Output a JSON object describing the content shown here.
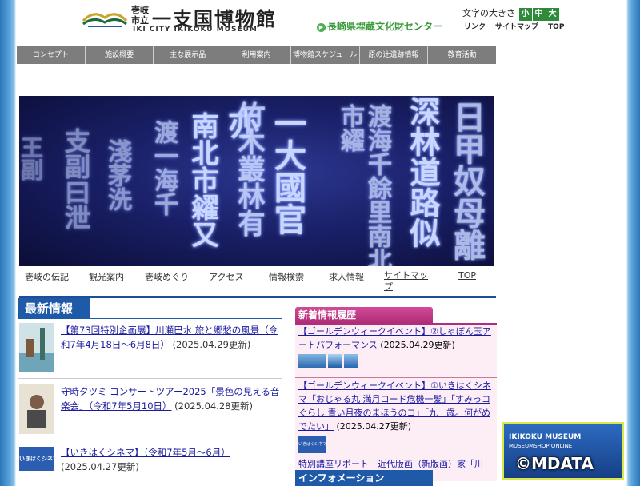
{
  "header": {
    "logo_small_line1": "壱岐",
    "logo_small_line2": "市立",
    "title": "一支国博物館",
    "subtitle": "IKI CITY IKIKOKU MUSEUM",
    "center_link": "長崎県埋蔵文化財センター",
    "font_size_label": "文字の大きさ",
    "font_sizes": [
      "小",
      "中",
      "大"
    ],
    "top_links": [
      "リンク",
      "サイトマップ",
      "TOP"
    ]
  },
  "main_menu": [
    "コンセプト",
    "施設概要",
    "主な展示品",
    "利用案内",
    "博物館スケジュール",
    "原の辻遺跡情報",
    "教育活動"
  ],
  "hero": {
    "columns": [
      "日甲奴母離",
      "深林道路似",
      "渡海千餘里南北市糴",
      "一大國官亦",
      "竹木叢林有",
      "南北市糴又",
      "渡一海千",
      "淺茅洗",
      "支副曰泄",
      "王副"
    ]
  },
  "sub_nav": [
    "壱岐の伝記",
    "観光案内",
    "壱岐めぐり",
    "アクセス",
    "情報検索",
    "求人情報",
    "サイトマップ",
    "TOP"
  ],
  "news": {
    "heading": "最新情報",
    "items": [
      {
        "title": "【第73回特別企画展】川瀬巴水 旅と郷愁の風景（令和7年4月18日～6月8日）",
        "date": "(2025.04.29更新)"
      },
      {
        "title": "守時タツミ コンサートツアー2025「景色の見える音楽会」（令和7年5月10日）",
        "date": "(2025.04.28更新)"
      },
      {
        "title": "【いきはくシネマ】（令和7年5月～6月）",
        "date": "(2025.04.27更新)"
      }
    ]
  },
  "history": {
    "heading": "新着情報履歴",
    "items": [
      {
        "title": "【ゴールデンウィークイベント】②しゃぼん玉アートパフォーマンス",
        "date": "(2025.04.29更新)"
      },
      {
        "title": "【ゴールデンウィークイベント】①いきはくシネマ「おじゃる丸 満月ロード危機一髪」「すみっコぐらし 青い月夜のまほうのコ」「九十歳。何がめでたい」",
        "date": "(2025.04.27更新)"
      },
      {
        "title": "特別講座リポート　近代版画（新版画）家「川",
        "date": ""
      }
    ],
    "thumb_label": "いきはくシネマ"
  },
  "info_heading": "インフォメーション",
  "shop": {
    "line1": "IKIKOKU MUSEUM",
    "line2": "MUSEUMSHOP ONLINE"
  },
  "watermark": "©MDATA",
  "colors": {
    "menu_gray": "#7d7d7d",
    "brand_blue": "#1e5aa8",
    "accent_green": "#2e8b3a",
    "history_pink": "#b02d77"
  }
}
